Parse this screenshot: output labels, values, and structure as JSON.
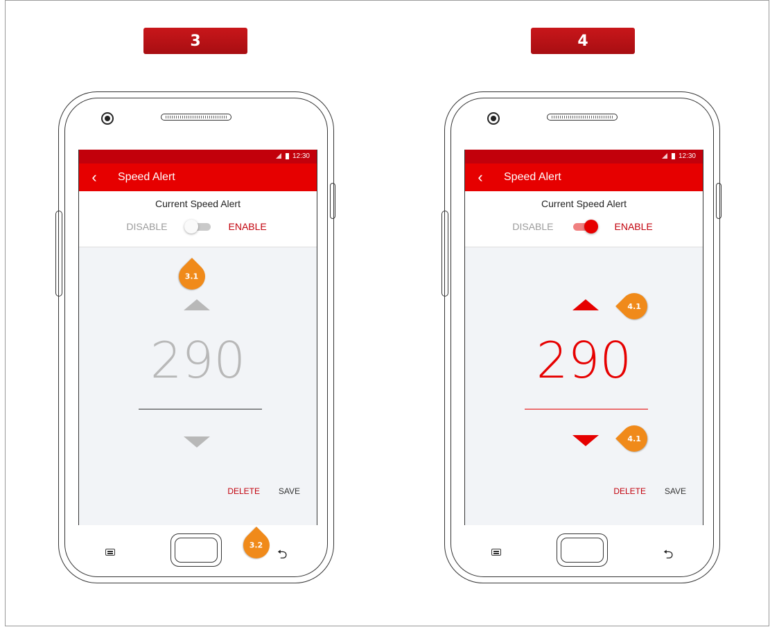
{
  "panels": [
    {
      "step_label": "3",
      "status_time": "12:30",
      "title": "Speed Alert",
      "current_label": "Current Speed Alert",
      "disable_label": "DISABLE",
      "enable_label": "ENABLE",
      "toggle_on": false,
      "speed_value": "290",
      "delete_label": "DELETE",
      "save_label": "SAVE",
      "callouts": [
        "3.1",
        "3.2"
      ]
    },
    {
      "step_label": "4",
      "status_time": "12:30",
      "title": "Speed Alert",
      "current_label": "Current Speed Alert",
      "disable_label": "DISABLE",
      "enable_label": "ENABLE",
      "toggle_on": true,
      "speed_value": "290",
      "delete_label": "DELETE",
      "save_label": "SAVE",
      "callouts": [
        "4.1",
        "4.1"
      ]
    }
  ],
  "colors": {
    "brand_red": "#e60000",
    "status_red": "#c2000b",
    "callout_orange": "#f08a1a",
    "disabled_gray": "#b8b8b8"
  }
}
